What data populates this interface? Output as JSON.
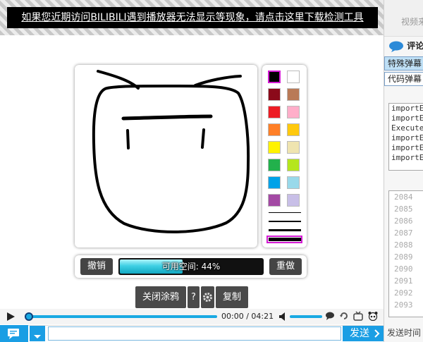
{
  "notice": {
    "text": "如果您近期访问BILIBILI遇到播放器无法显示等现象，请点击这里下载检测工具"
  },
  "palette": {
    "swatches": [
      {
        "name": "black",
        "color": "#000000",
        "selected": true
      },
      {
        "name": "white",
        "color": "#ffffff"
      },
      {
        "name": "dark-red",
        "color": "#8b0a1a"
      },
      {
        "name": "brown",
        "color": "#b97a57"
      },
      {
        "name": "red",
        "color": "#ed1c24"
      },
      {
        "name": "pink",
        "color": "#ffaec9"
      },
      {
        "name": "orange",
        "color": "#ff7f27"
      },
      {
        "name": "gold",
        "color": "#ffc90e"
      },
      {
        "name": "yellow",
        "color": "#fff200"
      },
      {
        "name": "cream",
        "color": "#efe4b0"
      },
      {
        "name": "green",
        "color": "#22b14c"
      },
      {
        "name": "lime",
        "color": "#b5e61d"
      },
      {
        "name": "blue",
        "color": "#00a2e8"
      },
      {
        "name": "light-blue",
        "color": "#99d9ea"
      },
      {
        "name": "purple",
        "color": "#a349a4"
      },
      {
        "name": "lavender",
        "color": "#c8bfe7"
      }
    ],
    "brushes": [
      "thin",
      "medium",
      "thick",
      "thickest"
    ],
    "selected_brush": "thickest"
  },
  "toolbar": {
    "undo_label": "撤销",
    "redo_label": "重做",
    "space_text": "可用空间: 44%",
    "space_fraction": 0.44
  },
  "actions": {
    "close_doodle_label": "关闭涂鸦",
    "help_label": "?",
    "copy_label": "复制"
  },
  "player": {
    "current_time": "00:00",
    "separator": "/",
    "duration": "04:21"
  },
  "send": {
    "send_label": "发送"
  },
  "sidebar": {
    "top_text": "视频来",
    "comment_label": "评论",
    "tabs": [
      {
        "label": "特殊弹幕",
        "active": true
      },
      {
        "label": "代码弹幕",
        "active": false
      }
    ],
    "code_lines": [
      "importE",
      "importE",
      "Execute",
      "importE",
      "importE",
      "importE"
    ],
    "line_numbers": [
      "2084",
      "2085",
      "2086",
      "2087",
      "2088",
      "2089",
      "2090",
      "2091",
      "2092",
      "2093"
    ],
    "bottom_text": "发送时间"
  },
  "colors": {
    "accent": "#1a9ee4",
    "selection": "#d41bd4"
  }
}
